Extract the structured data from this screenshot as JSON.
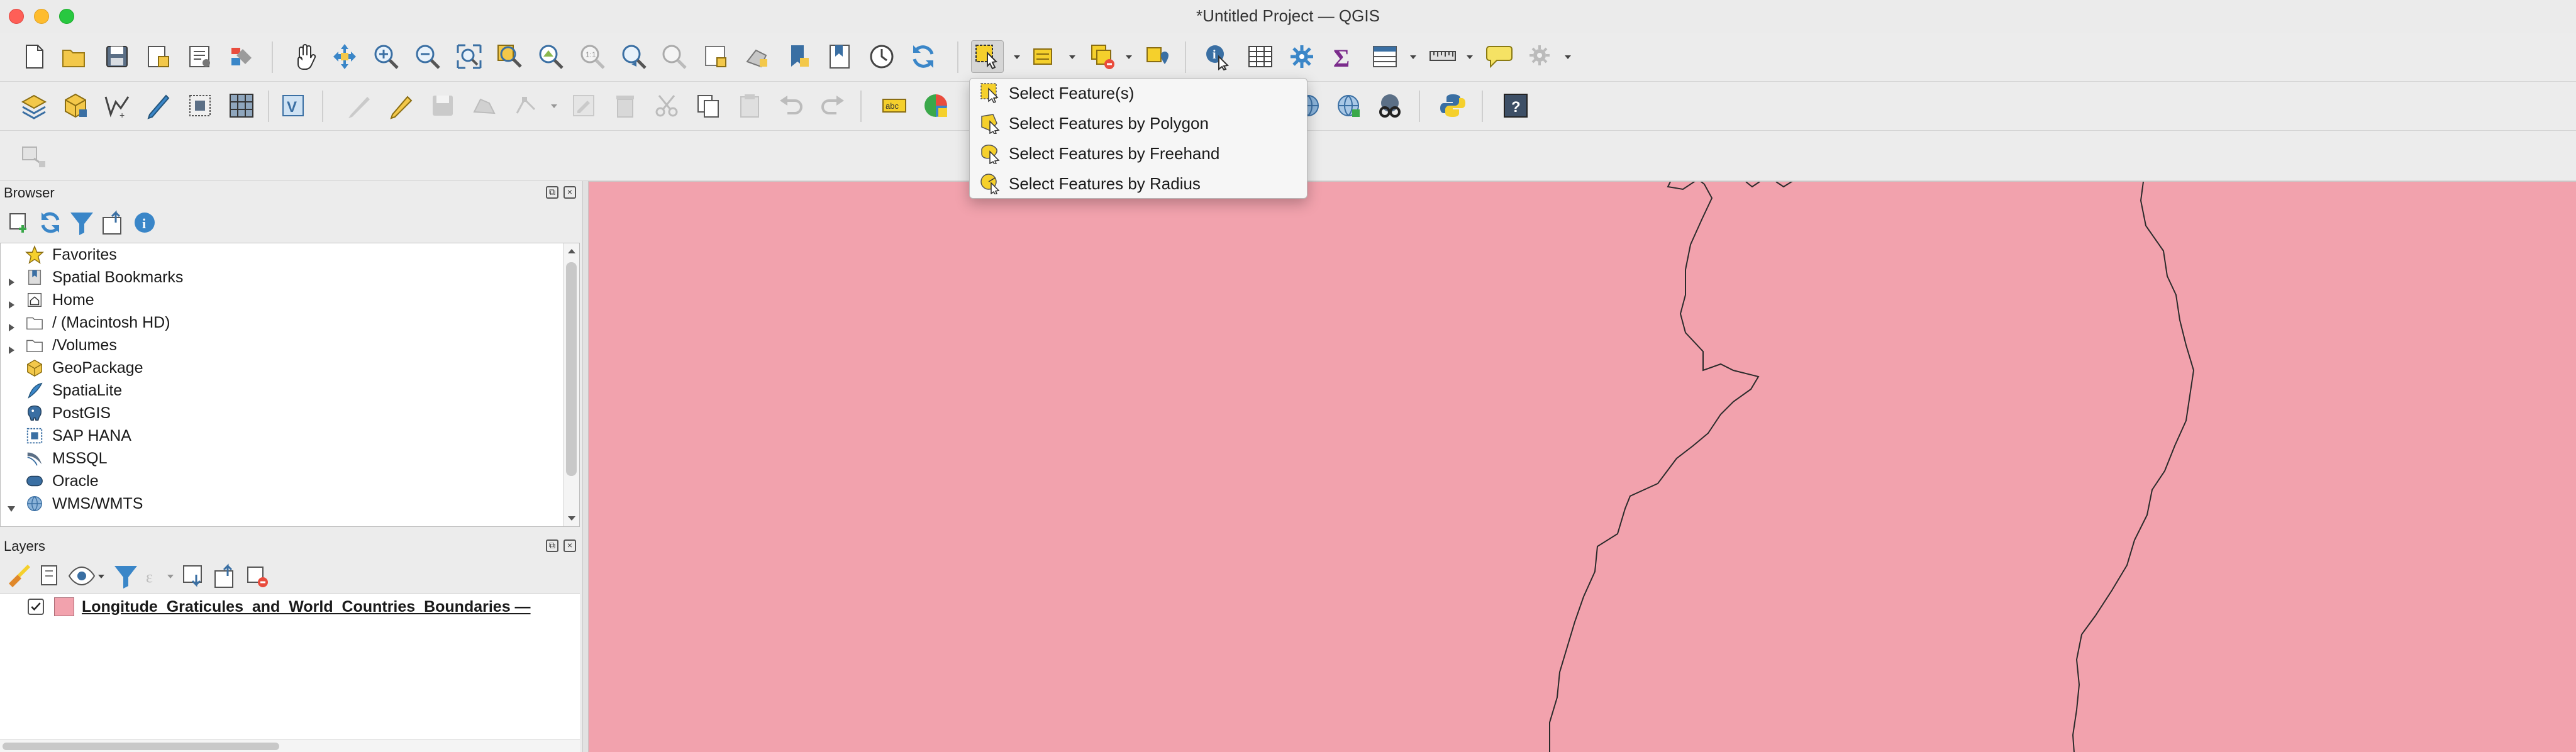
{
  "window": {
    "title": "*Untitled Project — QGIS"
  },
  "colors": {
    "map_fill": "#f2a2ad",
    "layer_swatch": "#f2a2ad",
    "accent_yellow": "#f5d02c"
  },
  "toolbar1": {
    "icons": [
      "new-project",
      "open-project",
      "save-project",
      "new-print-layout",
      "layout-manager",
      "style-manager",
      "pan",
      "pan-to-selection",
      "zoom-in",
      "zoom-out",
      "zoom-full",
      "zoom-to-selection",
      "zoom-to-layer",
      "zoom-native",
      "zoom-last",
      "zoom-next",
      "new-map-view",
      "new-3d-view",
      "new-bookmark",
      "show-bookmarks",
      "temporal-controller",
      "refresh",
      "select-features",
      "select-by-value",
      "deselect",
      "select-location",
      "identify",
      "attribute-table-stats",
      "processing-toolbox",
      "statistical-summary",
      "open-attribute-table",
      "measure",
      "map-tips",
      "actions"
    ]
  },
  "toolbar2": {
    "icons": [
      "data-source-manager",
      "new-geopackage-layer",
      "new-shapefile-layer",
      "new-temporary-layer",
      "new-spatialite",
      "new-virtual-layer",
      "digitize-tool",
      "current-edits",
      "toggle-editing",
      "save-edits",
      "add-feature",
      "vertex-tool",
      "delete-selected",
      "cut-features",
      "copy-features",
      "paste-features",
      "undo",
      "redo",
      "label-tool",
      "diagram-tool",
      "wms-layer",
      "wfs-layer",
      "metasearch",
      "python-console",
      "help"
    ]
  },
  "menu": {
    "items": [
      {
        "label": "Select Feature(s)",
        "icon": "select-feature-icon"
      },
      {
        "label": "Select Features by Polygon",
        "icon": "select-polygon-icon"
      },
      {
        "label": "Select Features by Freehand",
        "icon": "select-freehand-icon"
      },
      {
        "label": "Select Features by Radius",
        "icon": "select-radius-icon"
      }
    ]
  },
  "browser": {
    "title": "Browser",
    "items": [
      {
        "label": "Favorites",
        "icon": "star-icon",
        "expander": "none"
      },
      {
        "label": "Spatial Bookmarks",
        "icon": "bookmark-icon",
        "expander": "collapsed"
      },
      {
        "label": "Home",
        "icon": "home-icon",
        "expander": "collapsed"
      },
      {
        "label": "/ (Macintosh HD)",
        "icon": "folder-icon",
        "expander": "collapsed"
      },
      {
        "label": "/Volumes",
        "icon": "folder-icon",
        "expander": "collapsed"
      },
      {
        "label": "GeoPackage",
        "icon": "geopackage-icon",
        "expander": "none"
      },
      {
        "label": "SpatiaLite",
        "icon": "spatialite-icon",
        "expander": "none"
      },
      {
        "label": "PostGIS",
        "icon": "postgis-icon",
        "expander": "none"
      },
      {
        "label": "SAP HANA",
        "icon": "saphana-icon",
        "expander": "none"
      },
      {
        "label": "MSSQL",
        "icon": "mssql-icon",
        "expander": "none"
      },
      {
        "label": "Oracle",
        "icon": "oracle-icon",
        "expander": "none"
      },
      {
        "label": "WMS/WMTS",
        "icon": "wms-icon",
        "expander": "expanded"
      }
    ]
  },
  "layers": {
    "title": "Layers",
    "items": [
      {
        "label": "Longitude_Graticules_and_World_Countries_Boundaries — ",
        "checked": true
      }
    ]
  }
}
